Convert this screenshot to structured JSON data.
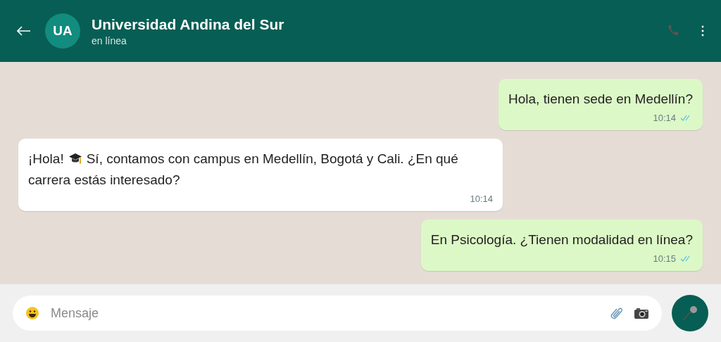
{
  "header": {
    "avatar": "UA",
    "title": "Universidad Andina del Sur",
    "status": "en línea"
  },
  "messages": [
    {
      "kind": "sent",
      "text": "Hola, tienen sede en Medellín?",
      "time": "10:14",
      "read": true
    },
    {
      "kind": "received",
      "lead": "¡Hola!",
      "text": "Sí, contamos con campus en Medellín, Bogotá y Cali. ¿En qué carrera estás interesado?",
      "time": "10:14"
    },
    {
      "kind": "sent",
      "text": "En Psicología. ¿Tienen modalidad en línea?",
      "time": "10:15",
      "read": true
    }
  ],
  "composer": {
    "placeholder": "Mensaje"
  }
}
